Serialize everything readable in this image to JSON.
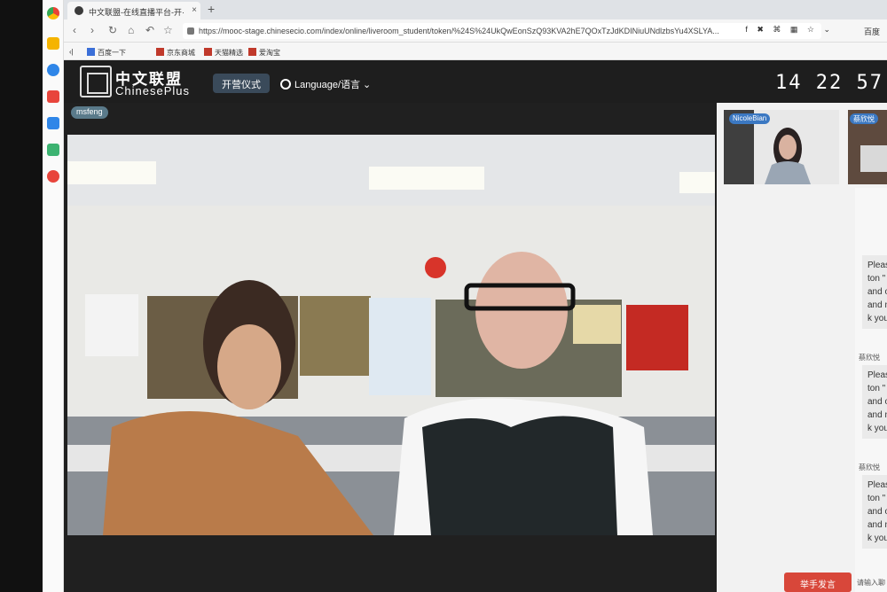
{
  "browser": {
    "tab_title": "中文联盟-在线直播平台-开·",
    "tab_close": "×",
    "new_tab": "+",
    "url": "https://mooc-stage.chinesecio.com/index/online/liveroom_student/token/%24S%24UkQwEonSzQ93KVA2hE7QOxTzJdKDINiuUNdlzbsYu4XSLYA...",
    "search_engine": "百度",
    "bookmarks": [
      "百度一下",
      "京东商城",
      "天猫精选",
      "爱淘宝"
    ]
  },
  "app": {
    "brand_cn": "中文联盟",
    "brand_en": "ChinesePlus",
    "ceremony_button": "开营仪式",
    "language_menu": "Language/语言",
    "clock": "14 22 57"
  },
  "stage": {
    "speaker_tag": "msfeng"
  },
  "right_panel": {
    "thumb_1_label": "NicoleBian",
    "thumb_2_label": "蔡欣悦",
    "messages": [
      {
        "who": "",
        "lines": [
          "Pleas",
          "ton \"",
          "and o",
          "and m",
          "k you"
        ]
      },
      {
        "who": "蔡欣悦",
        "lines": [
          "Please",
          "ton \"",
          "and o",
          "and m",
          "k you"
        ]
      },
      {
        "who": "蔡欣悦",
        "lines": [
          "Pleas",
          "ton \"",
          "and o",
          "and m",
          "k you"
        ]
      }
    ],
    "raise_hand": "举手发言",
    "chat_placeholder": "请输入聊"
  },
  "colors": {
    "header_bg": "#1e1e1e",
    "accent_red": "#d8473a",
    "tag_blue": "#3b78c2"
  }
}
